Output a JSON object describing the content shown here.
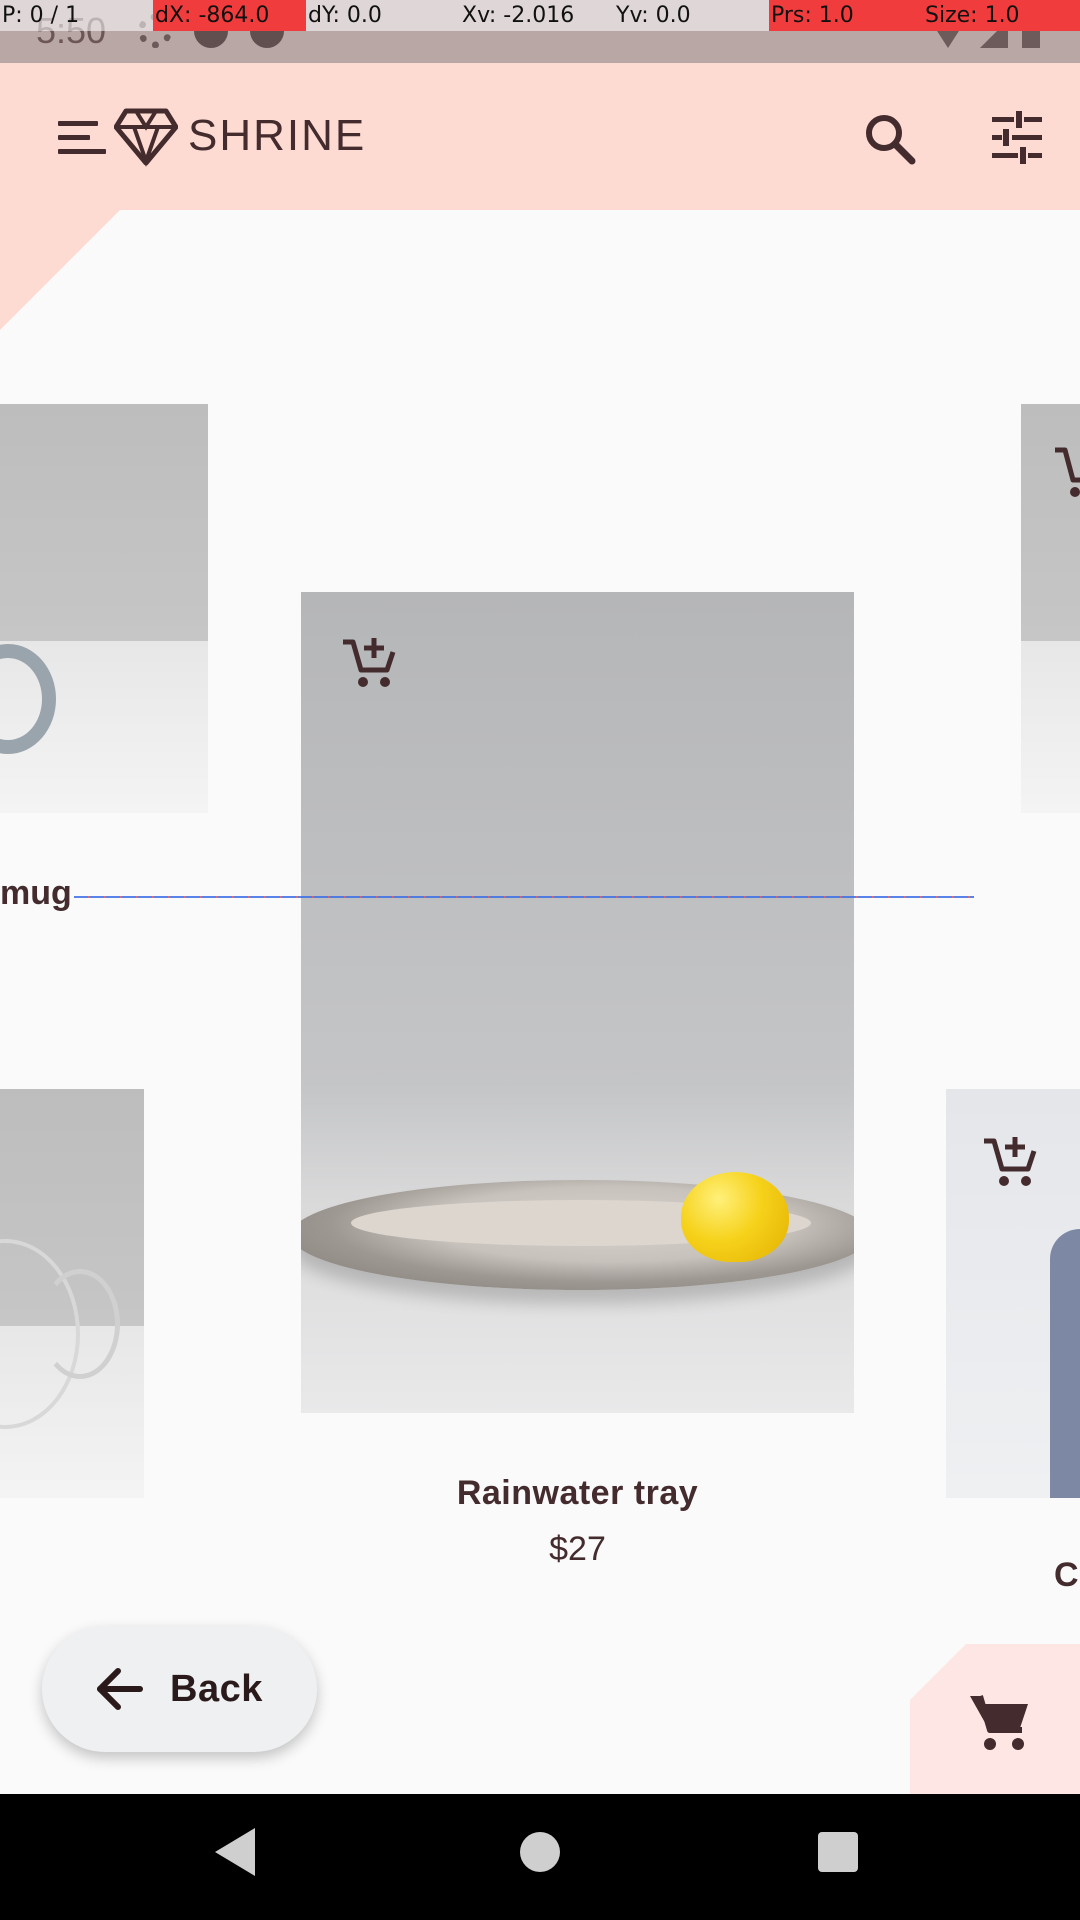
{
  "status_bar": {
    "time": "5:50"
  },
  "debug_overlay": {
    "pointer": "P: 0 / 1",
    "dx": "dX: -864.0",
    "dy": "dY: 0.0",
    "xv": "Xv: -2.016",
    "yv": "Yv: 0.0",
    "pressure": "Prs: 1.0",
    "size": "Size: 1.0"
  },
  "app_bar": {
    "brand": "SHRINE",
    "menu_icon": "menu-icon",
    "logo_icon": "diamond-logo-icon",
    "search_icon": "search-icon",
    "filter_icon": "tune-icon"
  },
  "products": {
    "featured": {
      "name": "Rainwater tray",
      "price": "$27"
    },
    "left_partial_label": "mug",
    "right_partial_label": "C"
  },
  "back_button": {
    "label": "Back",
    "icon": "arrow-back-icon"
  },
  "cart": {
    "icon": "shopping-cart-icon"
  },
  "colors": {
    "app_bar": "#fddbd3",
    "text": "#442c2e",
    "background": "#fafafa",
    "back_button": "#eef0f1"
  }
}
